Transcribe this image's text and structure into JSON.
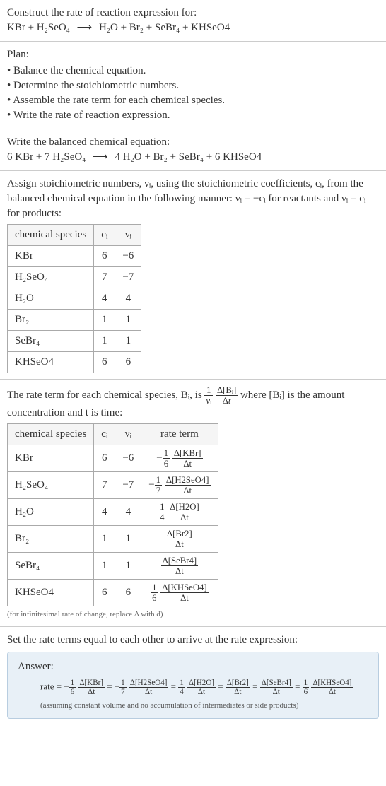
{
  "header": {
    "prompt": "Construct the rate of reaction expression for:",
    "equation_lhs": "KBr + H₂SeO₄",
    "equation_rhs": "H₂O + Br₂ + SeBr₄ + KHSeO4"
  },
  "plan": {
    "title": "Plan:",
    "items": [
      "Balance the chemical equation.",
      "Determine the stoichiometric numbers.",
      "Assemble the rate term for each chemical species.",
      "Write the rate of reaction expression."
    ]
  },
  "balanced": {
    "title": "Write the balanced chemical equation:",
    "lhs": "6 KBr + 7 H₂SeO₄",
    "rhs": "4 H₂O + Br₂ + SeBr₄ + 6 KHSeO4"
  },
  "stoich": {
    "intro_a": "Assign stoichiometric numbers, νᵢ, using the stoichiometric coefficients, cᵢ, from the balanced chemical equation in the following manner: νᵢ = −cᵢ for reactants and νᵢ = cᵢ for products:",
    "headers": [
      "chemical species",
      "cᵢ",
      "νᵢ"
    ],
    "rows": [
      {
        "sp": "KBr",
        "c": "6",
        "v": "−6"
      },
      {
        "sp": "H₂SeO₄",
        "c": "7",
        "v": "−7"
      },
      {
        "sp": "H₂O",
        "c": "4",
        "v": "4"
      },
      {
        "sp": "Br₂",
        "c": "1",
        "v": "1"
      },
      {
        "sp": "SeBr₄",
        "c": "1",
        "v": "1"
      },
      {
        "sp": "KHSeO4",
        "c": "6",
        "v": "6"
      }
    ]
  },
  "rate_term": {
    "intro_a": "The rate term for each chemical species, Bᵢ, is ",
    "intro_b": " where [Bᵢ] is the amount concentration and t is time:",
    "headers": [
      "chemical species",
      "cᵢ",
      "νᵢ",
      "rate term"
    ],
    "rows": [
      {
        "sp": "KBr",
        "c": "6",
        "v": "−6",
        "coef_num": "1",
        "coef_den": "6",
        "sign": "−",
        "delta": "Δ[KBr]"
      },
      {
        "sp": "H₂SeO₄",
        "c": "7",
        "v": "−7",
        "coef_num": "1",
        "coef_den": "7",
        "sign": "−",
        "delta": "Δ[H2SeO4]"
      },
      {
        "sp": "H₂O",
        "c": "4",
        "v": "4",
        "coef_num": "1",
        "coef_den": "4",
        "sign": "",
        "delta": "Δ[H2O]"
      },
      {
        "sp": "Br₂",
        "c": "1",
        "v": "1",
        "coef_num": "",
        "coef_den": "",
        "sign": "",
        "delta": "Δ[Br2]"
      },
      {
        "sp": "SeBr₄",
        "c": "1",
        "v": "1",
        "coef_num": "",
        "coef_den": "",
        "sign": "",
        "delta": "Δ[SeBr4]"
      },
      {
        "sp": "KHSeO4",
        "c": "6",
        "v": "6",
        "coef_num": "1",
        "coef_den": "6",
        "sign": "",
        "delta": "Δ[KHSeO4]"
      }
    ],
    "note": "(for infinitesimal rate of change, replace Δ with d)"
  },
  "final": {
    "title": "Set the rate terms equal to each other to arrive at the rate expression:",
    "answer_label": "Answer:",
    "rate_prefix": "rate = ",
    "terms": [
      {
        "sign": "−",
        "coef_num": "1",
        "coef_den": "6",
        "delta": "Δ[KBr]"
      },
      {
        "sign": "−",
        "coef_num": "1",
        "coef_den": "7",
        "delta": "Δ[H2SeO4]"
      },
      {
        "sign": "",
        "coef_num": "1",
        "coef_den": "4",
        "delta": "Δ[H2O]"
      },
      {
        "sign": "",
        "coef_num": "",
        "coef_den": "",
        "delta": "Δ[Br2]"
      },
      {
        "sign": "",
        "coef_num": "",
        "coef_den": "",
        "delta": "Δ[SeBr4]"
      },
      {
        "sign": "",
        "coef_num": "1",
        "coef_den": "6",
        "delta": "Δ[KHSeO4]"
      }
    ],
    "assumption": "(assuming constant volume and no accumulation of intermediates or side products)"
  },
  "dt": "Δt"
}
